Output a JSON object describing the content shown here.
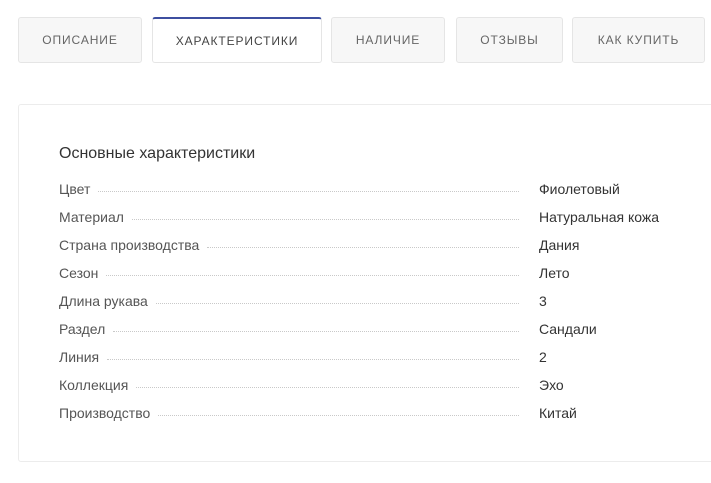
{
  "tabs": [
    {
      "label": "Описание",
      "active": false
    },
    {
      "label": "Характеристики",
      "active": true
    },
    {
      "label": "Наличие",
      "active": false
    },
    {
      "label": "Отзывы",
      "active": false
    },
    {
      "label": "Как купить",
      "active": false
    }
  ],
  "panel": {
    "title": "Основные характеристики",
    "properties": [
      {
        "name": "Цвет",
        "value": "Фиолетовый"
      },
      {
        "name": "Материал",
        "value": "Натуральная кожа"
      },
      {
        "name": "Страна производства",
        "value": "Дания"
      },
      {
        "name": "Сезон",
        "value": "Лето"
      },
      {
        "name": "Длина рукава",
        "value": "3"
      },
      {
        "name": "Раздел",
        "value": "Сандали"
      },
      {
        "name": "Линия",
        "value": "2"
      },
      {
        "name": "Коллекция",
        "value": "Эхо"
      },
      {
        "name": "Производство",
        "value": "Китай"
      }
    ]
  },
  "colors": {
    "active_tab_accent": "#3d4fa0",
    "tab_background": "#f7f7f7",
    "border": "#e5e5e5"
  }
}
